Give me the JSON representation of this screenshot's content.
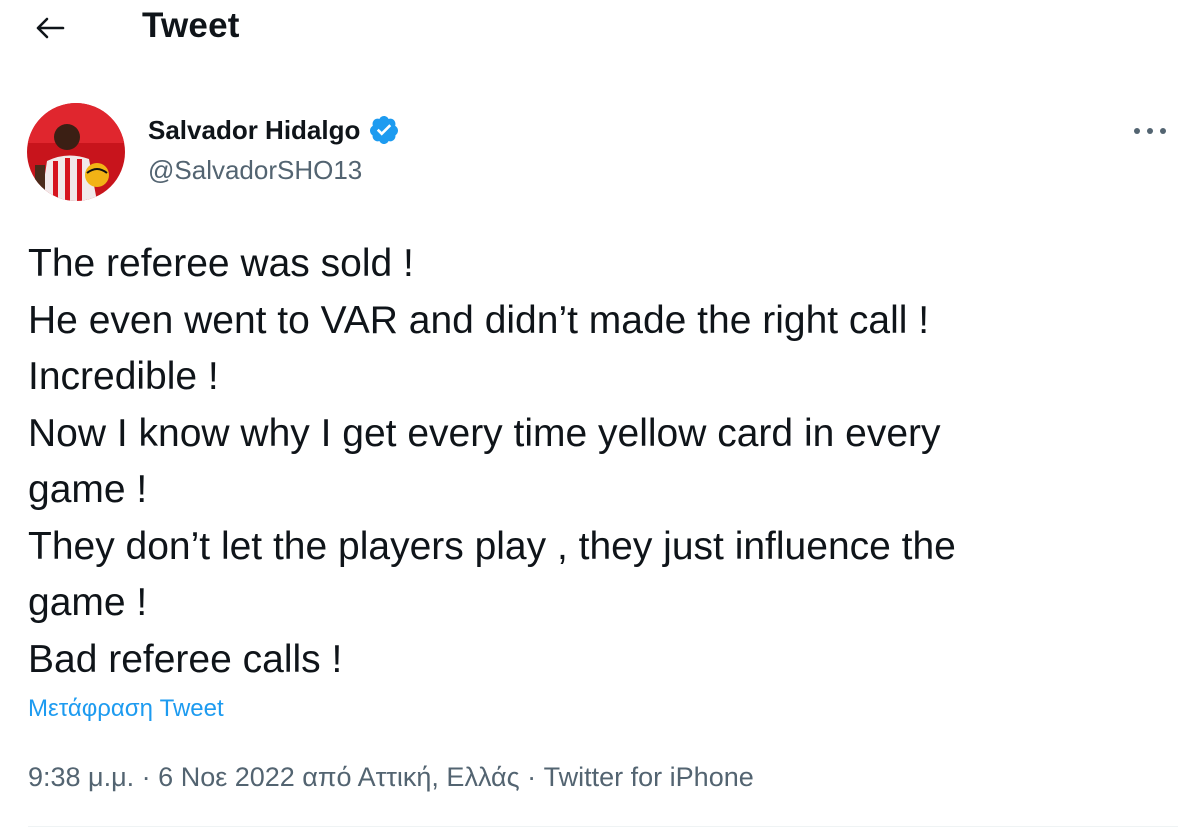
{
  "header": {
    "title": "Tweet",
    "back_icon": "arrow-left-icon"
  },
  "author": {
    "display_name": "Salvador Hidalgo",
    "handle": "@SalvadorSHO13",
    "verified_icon": "verified-badge-icon",
    "verified_color": "#1d9bf0"
  },
  "tweet": {
    "lines": [
      "The referee was sold !",
      "He even went to VAR and didn’t made the right call !",
      "Incredible !",
      "Now I know why I get every time yellow card in every",
      "game !",
      "They don’t let the players play , they just influence the",
      "game !",
      "Bad referee calls !"
    ],
    "translate_label": "Μετάφραση Tweet"
  },
  "meta": {
    "time": "9:38 μ.μ.",
    "separator": " · ",
    "date_location": "6 Νοε 2022 από Αττική, Ελλάς",
    "source": "Twitter for iPhone"
  },
  "colors": {
    "text": "#0f1419",
    "secondary": "#536471",
    "accent": "#1d9bf0"
  }
}
